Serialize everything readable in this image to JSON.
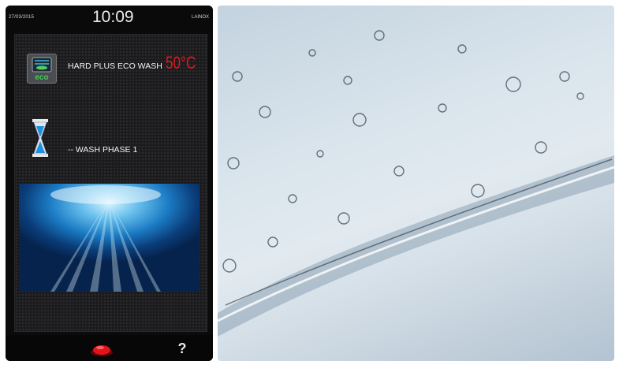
{
  "status_bar": {
    "date": "27/03/2015",
    "time": "10:09",
    "brand": "LAINOX"
  },
  "program": {
    "icon": "eco-wash-icon",
    "icon_text": "eco",
    "label": "HARD PLUS ECO WASH",
    "temperature": "50°C"
  },
  "phase": {
    "icon": "hourglass-icon",
    "label": "-- WASH PHASE 1"
  },
  "bottom_bar": {
    "start_icon": "red-start-button-icon",
    "help_label": "?",
    "help_icon": "help-icon"
  },
  "photo": {
    "subject": "water-splash-photo"
  },
  "colors": {
    "temperature": "#e2161b",
    "screen_bg": "#1b1b1d",
    "water_blue": "#1b7bc4",
    "start_red": "#e3131a"
  }
}
